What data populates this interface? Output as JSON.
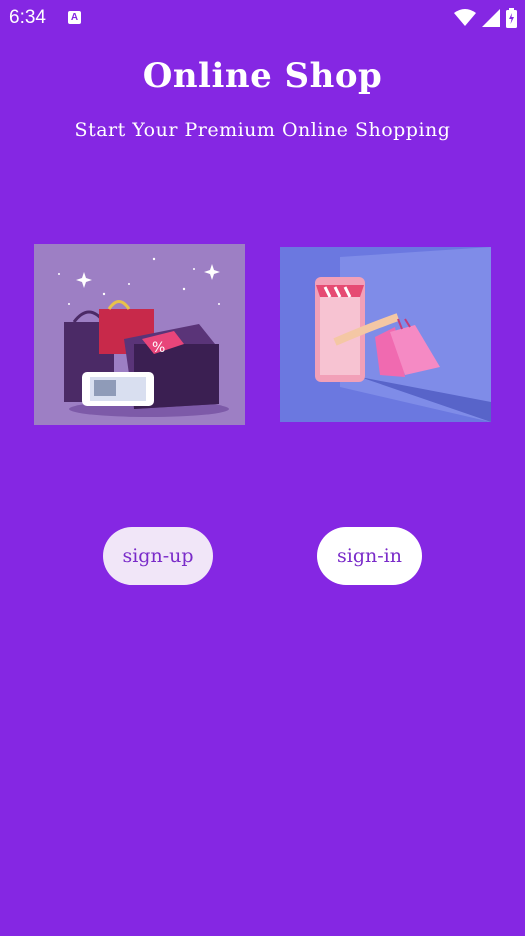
{
  "status_bar": {
    "time": "6:34",
    "notification_glyph": "A"
  },
  "header": {
    "title": "Online Shop",
    "subtitle": "Start Your Premium Online Shopping"
  },
  "images": [
    {
      "icon": "shopping-bags-box-illustration"
    },
    {
      "icon": "phone-shopping-bags-illustration"
    }
  ],
  "buttons": {
    "signup_label": "sign-up",
    "signin_label": "sign-in"
  },
  "colors": {
    "background": "#8527e3",
    "accent_text": "#7a2bc9",
    "signup_bg": "#f1e6f8",
    "signin_bg": "#ffffff"
  }
}
